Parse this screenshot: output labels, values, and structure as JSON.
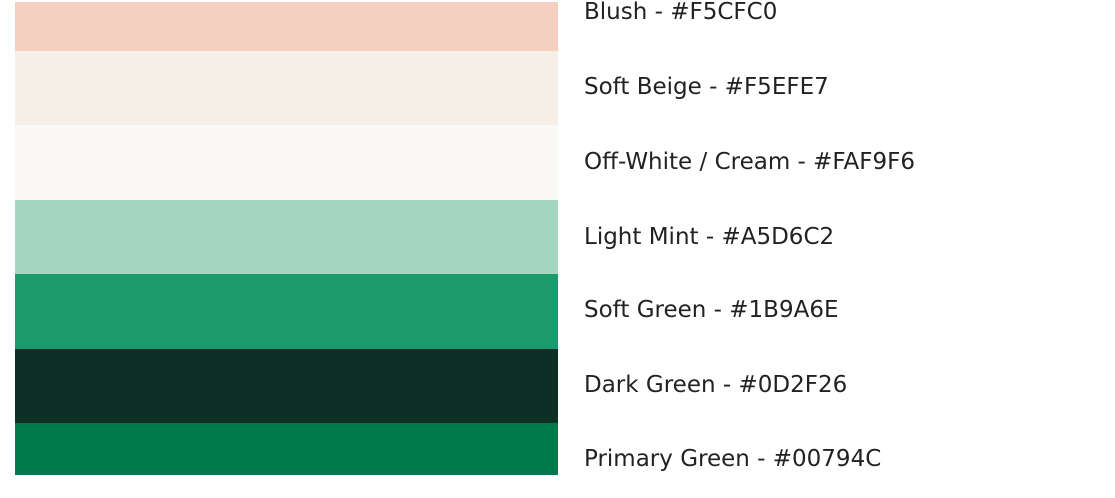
{
  "palette": {
    "colors": [
      {
        "label": "Blush - #F5CFC0",
        "hex": "#F5CFC0"
      },
      {
        "label": "Soft Beige - #F5EFE7",
        "hex": "#F5EFE7"
      },
      {
        "label": "Off-White / Cream - #FAF9F6",
        "hex": "#FAF9F6"
      },
      {
        "label": "Light Mint - #A5D6C2",
        "hex": "#A5D6C2"
      },
      {
        "label": "Soft Green - #1B9A6E",
        "hex": "#1B9A6E"
      },
      {
        "label": "Dark Green - #0D2F26",
        "hex": "#0D2F26"
      },
      {
        "label": "Primary Green - #00794C",
        "hex": "#00794C"
      }
    ]
  }
}
